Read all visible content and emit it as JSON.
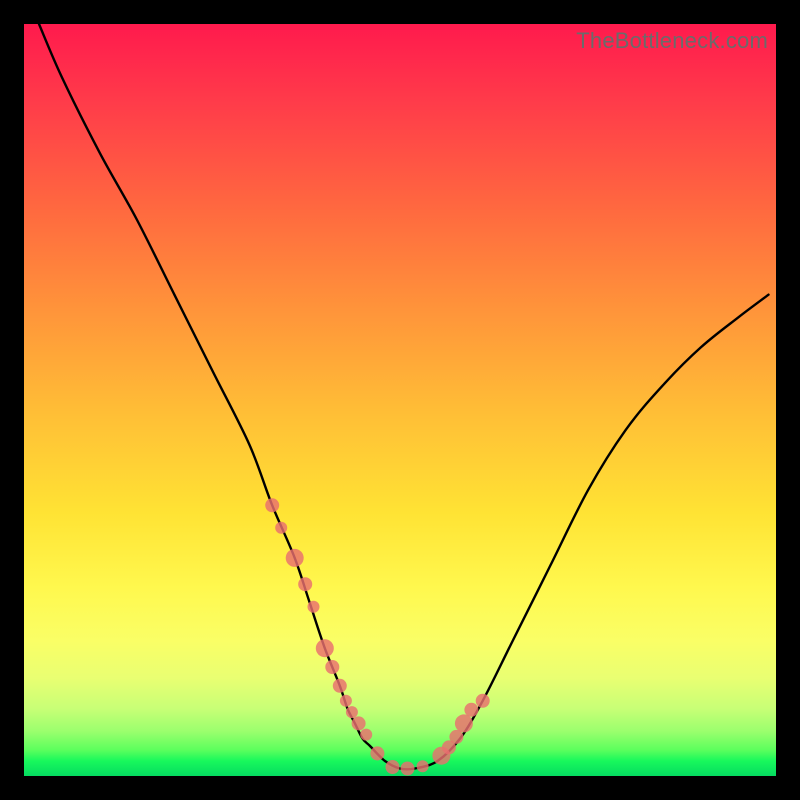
{
  "watermark": "TheBottleneck.com",
  "chart_data": {
    "type": "line",
    "title": "",
    "xlabel": "",
    "ylabel": "",
    "xlim": [
      0,
      100
    ],
    "ylim": [
      0,
      100
    ],
    "grid": false,
    "legend_position": "none",
    "series": [
      {
        "name": "curve",
        "stroke": "#000000",
        "x": [
          2,
          5,
          10,
          15,
          20,
          25,
          30,
          33,
          36,
          38,
          40,
          42,
          43,
          44,
          45,
          46,
          48,
          50,
          52,
          55,
          58,
          61,
          65,
          70,
          75,
          80,
          85,
          90,
          95,
          99
        ],
        "values": [
          100,
          93,
          83,
          74,
          64,
          54,
          44,
          36,
          29,
          23,
          17,
          12,
          9,
          7,
          5,
          4,
          2,
          1,
          1,
          2,
          5,
          10,
          18,
          28,
          38,
          46,
          52,
          57,
          61,
          64
        ]
      }
    ],
    "markers": {
      "name": "dots",
      "color": "#e96f6f",
      "x": [
        33.0,
        34.2,
        36.0,
        37.4,
        38.5,
        40.0,
        41.0,
        42.0,
        42.8,
        43.6,
        44.5,
        45.5,
        47.0,
        49.0,
        51.0,
        53.0,
        55.5,
        56.5,
        57.5,
        58.5,
        59.5,
        61.0
      ],
      "values": [
        36.0,
        33.0,
        29.0,
        25.5,
        22.5,
        17.0,
        14.5,
        12.0,
        10.0,
        8.5,
        7.0,
        5.5,
        3.0,
        1.2,
        1.0,
        1.3,
        2.7,
        3.8,
        5.2,
        7.0,
        8.8,
        10.0
      ],
      "radius": [
        7,
        6,
        9,
        7,
        6,
        9,
        7,
        7,
        6,
        6,
        7,
        6,
        7,
        7,
        7,
        6,
        9,
        7,
        7,
        9,
        7,
        7
      ]
    }
  }
}
